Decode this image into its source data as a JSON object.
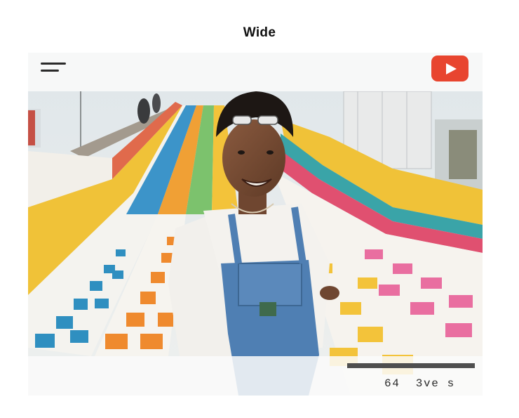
{
  "page": {
    "title": "Wide"
  },
  "player": {
    "menu_icon": "hamburger-menu-icon",
    "play_button_icon": "youtube-play-icon",
    "accent_color": "#e8452f",
    "progress_fraction": 1.0,
    "caption": "64  3ve s"
  },
  "scene": {
    "description_icon": "video-frame-woman-on-giant-slide"
  }
}
